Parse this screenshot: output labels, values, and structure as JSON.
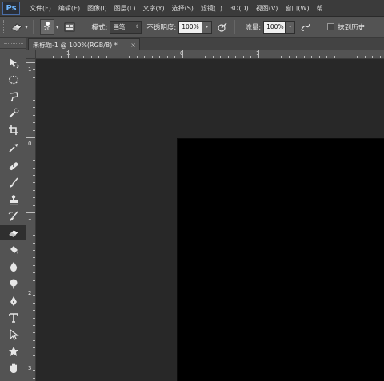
{
  "app": {
    "logo": "Ps"
  },
  "menu": {
    "items": [
      "文件(F)",
      "编辑(E)",
      "图像(I)",
      "图层(L)",
      "文字(Y)",
      "选择(S)",
      "滤镜(T)",
      "3D(D)",
      "视图(V)",
      "窗口(W)",
      "帮"
    ]
  },
  "options": {
    "brush_size": "20",
    "mode_label": "模式:",
    "mode_value": "画笔",
    "opacity_label": "不透明度:",
    "opacity_value": "100%",
    "flow_label": "流量:",
    "flow_value": "100%",
    "erase_history_label": "抹到历史"
  },
  "document": {
    "tab_title": "未标题-1 @ 100%(RGB/8) *",
    "tab_close": "×"
  },
  "rulers": {
    "horizontal_labels": [
      "1",
      "0",
      "1"
    ],
    "vertical_labels": [
      "1",
      "0",
      "1",
      "2",
      "3"
    ]
  },
  "tools": {
    "active": "eraser-tool"
  },
  "colors": {
    "menubar": "#3b3b3b",
    "panel": "#535353",
    "workspace": "#282828",
    "canvas": "#000000",
    "ps_logo": "#6fb7ff"
  }
}
